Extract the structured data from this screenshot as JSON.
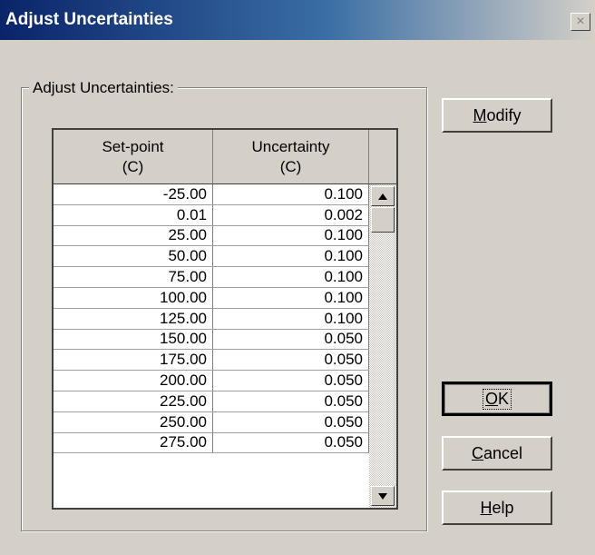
{
  "window": {
    "title": "Adjust Uncertainties",
    "close_glyph": "×"
  },
  "group": {
    "label": "Adjust Uncertainties:"
  },
  "table": {
    "headers": [
      {
        "line1": "Set-point",
        "line2": "(C)"
      },
      {
        "line1": "Uncertainty",
        "line2": "(C)"
      }
    ],
    "rows": [
      {
        "setpoint": "-25.00",
        "uncertainty": "0.100"
      },
      {
        "setpoint": "0.01",
        "uncertainty": "0.002"
      },
      {
        "setpoint": "25.00",
        "uncertainty": "0.100"
      },
      {
        "setpoint": "50.00",
        "uncertainty": "0.100"
      },
      {
        "setpoint": "75.00",
        "uncertainty": "0.100"
      },
      {
        "setpoint": "100.00",
        "uncertainty": "0.100"
      },
      {
        "setpoint": "125.00",
        "uncertainty": "0.100"
      },
      {
        "setpoint": "150.00",
        "uncertainty": "0.050"
      },
      {
        "setpoint": "175.00",
        "uncertainty": "0.050"
      },
      {
        "setpoint": "200.00",
        "uncertainty": "0.050"
      },
      {
        "setpoint": "225.00",
        "uncertainty": "0.050"
      },
      {
        "setpoint": "250.00",
        "uncertainty": "0.050"
      },
      {
        "setpoint": "275.00",
        "uncertainty": "0.050"
      }
    ]
  },
  "buttons": {
    "modify": {
      "pre": "",
      "key": "M",
      "post": "odify"
    },
    "ok": {
      "pre": "",
      "key": "O",
      "post": "K"
    },
    "cancel": {
      "pre": "",
      "key": "C",
      "post": "ancel"
    },
    "help": {
      "pre": "",
      "key": "H",
      "post": "elp"
    }
  },
  "icons": {
    "close": "close-icon",
    "scroll_up": "arrow-up-icon",
    "scroll_down": "arrow-down-icon"
  },
  "colors": {
    "title_bar_start": "#0a246a",
    "title_bar_end": "#3a6ea5",
    "face": "#d4d0c8"
  }
}
